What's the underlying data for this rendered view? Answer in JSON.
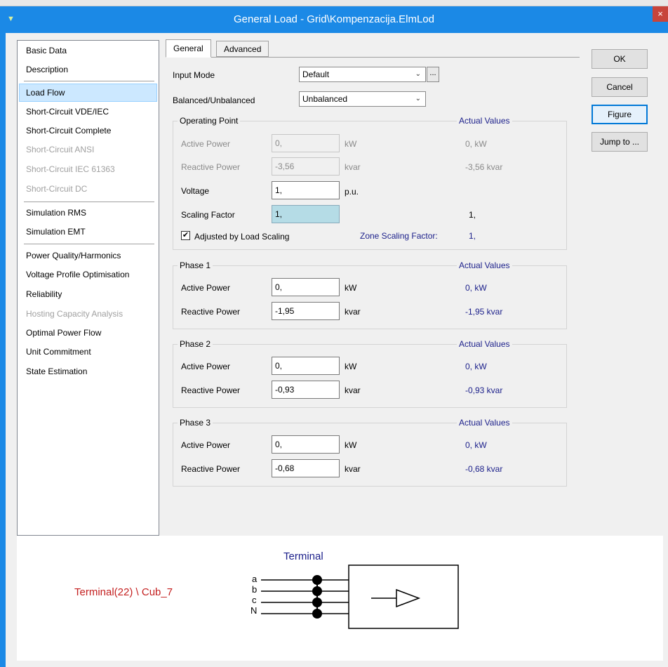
{
  "window": {
    "title": "General Load - Grid\\Kompenzacija.ElmLod",
    "close_glyph": "×",
    "system_icon": "▼"
  },
  "pages": [
    {
      "label": "Basic Data",
      "state": "normal"
    },
    {
      "label": "Description",
      "state": "normal"
    },
    {
      "label": "Load Flow",
      "state": "selected"
    },
    {
      "label": "Short-Circuit VDE/IEC",
      "state": "normal"
    },
    {
      "label": "Short-Circuit Complete",
      "state": "normal"
    },
    {
      "label": "Short-Circuit ANSI",
      "state": "disabled"
    },
    {
      "label": "Short-Circuit IEC 61363",
      "state": "disabled"
    },
    {
      "label": "Short-Circuit DC",
      "state": "disabled"
    },
    {
      "label": "Simulation RMS",
      "state": "normal"
    },
    {
      "label": "Simulation EMT",
      "state": "normal"
    },
    {
      "label": "Power Quality/Harmonics",
      "state": "normal"
    },
    {
      "label": "Voltage Profile Optimisation",
      "state": "normal"
    },
    {
      "label": "Reliability",
      "state": "normal"
    },
    {
      "label": "Hosting Capacity Analysis",
      "state": "disabled"
    },
    {
      "label": "Optimal Power Flow",
      "state": "normal"
    },
    {
      "label": "Unit Commitment",
      "state": "normal"
    },
    {
      "label": "State Estimation",
      "state": "normal"
    }
  ],
  "tabs": [
    {
      "label": "General",
      "active": true
    },
    {
      "label": "Advanced",
      "active": false
    }
  ],
  "input_mode": {
    "label": "Input Mode",
    "value": "Default",
    "ellipsis": "..."
  },
  "balanced": {
    "label": "Balanced/Unbalanced",
    "value": "Unbalanced"
  },
  "combo_arrow": "⌄",
  "operating_point": {
    "title": "Operating Point",
    "actual_title": "Actual Values",
    "active_power": {
      "label": "Active Power",
      "value": "0,",
      "unit": "kW",
      "actual": "0, kW"
    },
    "reactive_power": {
      "label": "Reactive Power",
      "value": "-3,56",
      "unit": "kvar",
      "actual": "-3,56 kvar"
    },
    "voltage": {
      "label": "Voltage",
      "value": "1,",
      "unit": "p.u."
    },
    "scaling": {
      "label": "Scaling Factor",
      "value": "1,",
      "actual": "1,"
    },
    "adjusted": {
      "label": "Adjusted by Load Scaling",
      "checked": true,
      "check_glyph": "✔"
    },
    "zone": {
      "label": "Zone Scaling Factor:",
      "value": "1,"
    }
  },
  "phases": [
    {
      "title": "Phase 1",
      "actual_title": "Actual Values",
      "active_power": {
        "label": "Active Power",
        "value": "0,",
        "unit": "kW",
        "actual": "0, kW"
      },
      "reactive_power": {
        "label": "Reactive Power",
        "value": "-1,95",
        "unit": "kvar",
        "actual": "-1,95 kvar"
      }
    },
    {
      "title": "Phase 2",
      "actual_title": "Actual Values",
      "active_power": {
        "label": "Active Power",
        "value": "0,",
        "unit": "kW",
        "actual": "0, kW"
      },
      "reactive_power": {
        "label": "Reactive Power",
        "value": "-0,93",
        "unit": "kvar",
        "actual": "-0,93 kvar"
      }
    },
    {
      "title": "Phase 3",
      "actual_title": "Actual Values",
      "active_power": {
        "label": "Active Power",
        "value": "0,",
        "unit": "kW",
        "actual": "0, kW"
      },
      "reactive_power": {
        "label": "Reactive Power",
        "value": "-0,68",
        "unit": "kvar",
        "actual": "-0,68 kvar"
      }
    }
  ],
  "buttons": {
    "ok": "OK",
    "cancel": "Cancel",
    "figure": "Figure",
    "jump": "Jump to ..."
  },
  "figure": {
    "terminal_title": "Terminal",
    "cubicle": "Terminal(22) \\ Cub_7",
    "phase_labels": [
      "a",
      "b",
      "c",
      "N"
    ]
  },
  "colors": {
    "title_bar": "#1b89e6",
    "selected_page": "#cce8ff",
    "label_blue": "#1b1f8a",
    "cubicle_red": "#c42020"
  }
}
